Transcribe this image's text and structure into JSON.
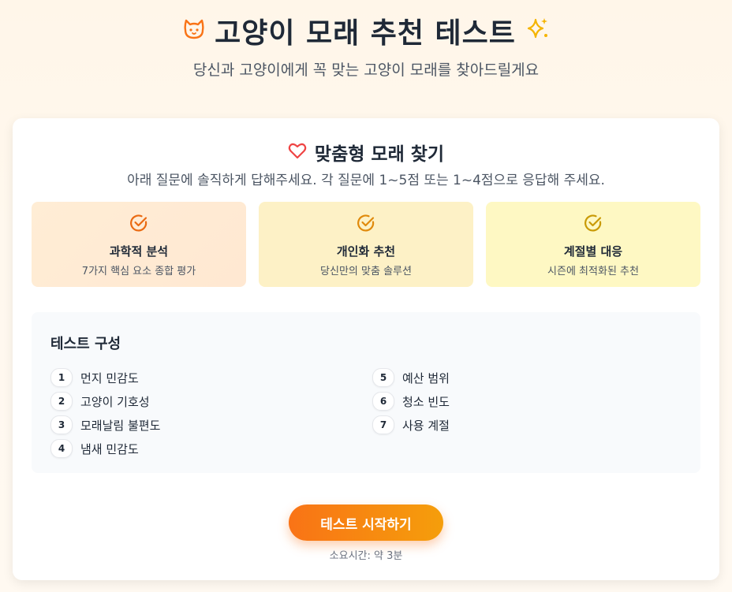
{
  "header": {
    "title": "고양이 모래 추천 테스트",
    "subtitle": "당신과 고양이에게 꼭 맞는 고양이 모래를 찾아드릴게요",
    "left_icon": "cat-icon",
    "right_icon": "sparkles-icon"
  },
  "card": {
    "title": "맞춤형 모래 찾기",
    "title_icon": "heart-icon",
    "description": "아래 질문에 솔직하게 답해주세요. 각 질문에 1~5점 또는 1~4점으로 응답해 주세요.",
    "features": [
      {
        "title": "과학적 분석",
        "desc": "7가지 핵심 요소 종합 평가",
        "icon": "check-circle-icon"
      },
      {
        "title": "개인화 추천",
        "desc": "당신만의 맞춤 솔루션",
        "icon": "check-circle-icon"
      },
      {
        "title": "계절별 대응",
        "desc": "시즌에 최적화된 추천",
        "icon": "check-circle-icon"
      }
    ],
    "composition": {
      "title": "테스트 구성",
      "items": [
        {
          "num": "1",
          "label": "먼지 민감도"
        },
        {
          "num": "2",
          "label": "고양이 기호성"
        },
        {
          "num": "3",
          "label": "모래날림 불편도"
        },
        {
          "num": "4",
          "label": "냄새 민감도"
        },
        {
          "num": "5",
          "label": "예산 범위"
        },
        {
          "num": "6",
          "label": "청소 빈도"
        },
        {
          "num": "7",
          "label": "사용 계절"
        }
      ]
    },
    "start_button": "테스트 시작하기",
    "duration": "소요시간: 약 3분"
  },
  "colors": {
    "accent": "#f97316",
    "accent_end": "#f59e0b",
    "heart": "#ef4444",
    "sparkle": "#f5b400",
    "check_1": "#ea6a12",
    "check_2": "#e08a0c",
    "check_3": "#c99a06"
  }
}
